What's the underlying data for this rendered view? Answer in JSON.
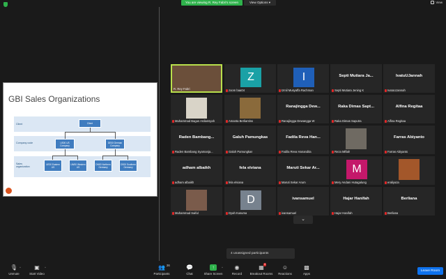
{
  "top": {
    "viewing_banner": "You are viewing R. Rey Fabri's screen",
    "view_options": "View Options",
    "view_label": "View"
  },
  "slide": {
    "title": "GBI Sales Organizations",
    "bands": [
      "Client",
      "Company code",
      "Sales organization"
    ],
    "client_box": "Client",
    "company_codes": [
      "US00 US Company",
      "DE00 German Company"
    ],
    "sales_orgs": [
      "UE00 Eastern US",
      "UW00 Western US",
      "DN00 Northern Germany",
      "DS00 Southern Germany"
    ]
  },
  "tiles": [
    {
      "kind": "photo",
      "label": "R. Rey Fabri",
      "active": true,
      "muted": false,
      "color": "#6b4f3a"
    },
    {
      "kind": "letter",
      "letter": "Z",
      "label": "zoom baa04",
      "color": "#1aa1a6",
      "muted": true
    },
    {
      "kind": "letter",
      "letter": "I",
      "label": "Izmil Musyaffa Rachman",
      "color": "#1f5fb8",
      "muted": true
    },
    {
      "kind": "name",
      "name": "Septi Mutiara Ja...",
      "label": "Septi Mutiara Jening K",
      "muted": true
    },
    {
      "kind": "name",
      "name": "IvatuUJannah",
      "label": "IvatuUJannah",
      "muted": true
    },
    {
      "kind": "photo",
      "label": "Muhammad Bagus Ardiansyah",
      "muted": true,
      "color": "#d9d4c8"
    },
    {
      "kind": "photo",
      "label": "Amanta Berliantino",
      "muted": true,
      "color": "#8a6a3b"
    },
    {
      "kind": "name",
      "name": "Ranajingga Dew...",
      "label": "Ranajingga Dewangga W",
      "muted": true
    },
    {
      "kind": "name",
      "name": "Raka Dimas Sapt...",
      "label": "Raka Dimas Saputra",
      "muted": true
    },
    {
      "kind": "name",
      "name": "Alfina Regitaa",
      "label": "Alfina Regitaa",
      "muted": true
    },
    {
      "kind": "name",
      "name": "Raden Bambang...",
      "label": "Raden Bambang Syamanja...",
      "muted": true
    },
    {
      "kind": "name",
      "name": "Galuh Pamungkas",
      "label": "Galuh Pamungkas",
      "muted": true
    },
    {
      "kind": "name",
      "name": "Fadila Reva Han...",
      "label": "Fadila Reva Hanandita",
      "muted": true
    },
    {
      "kind": "photo",
      "label": "Reza Miftah",
      "muted": true,
      "color": "#6f6a62"
    },
    {
      "kind": "name",
      "name": "Farras Abiyanto",
      "label": "Farras Abiyanto",
      "muted": true
    },
    {
      "kind": "name",
      "name": "adham albaikh",
      "label": "adham albaikh",
      "muted": true
    },
    {
      "kind": "name",
      "name": "fela elviana",
      "label": "fela elviana",
      "muted": true
    },
    {
      "kind": "name",
      "name": "Maruti Sekar Ar...",
      "label": "Maruti Sekar Arum",
      "muted": true
    },
    {
      "kind": "letter",
      "letter": "M",
      "label": "Mery Andani Hutagalung",
      "color": "#c4186a",
      "muted": true
    },
    {
      "kind": "photo",
      "label": "eraliyaza",
      "muted": true,
      "color": "#a3572a"
    },
    {
      "kind": "photo",
      "label": "Muhammad Saiful",
      "muted": true,
      "color": "#7a5b4b"
    },
    {
      "kind": "letter",
      "letter": "D",
      "label": "Dyah Kusuma",
      "color": "#77828e",
      "muted": true
    },
    {
      "kind": "name",
      "name": "ivansamuel",
      "label": "ivansamuel",
      "muted": true
    },
    {
      "kind": "name",
      "name": "Hajar Hanifah",
      "label": "Hajar Hanifah",
      "muted": true
    },
    {
      "kind": "name",
      "name": "Berliana",
      "label": "Berliana",
      "muted": true
    }
  ],
  "unassigned": "4 unassigned participants",
  "toolbar": {
    "unmute": "Unmute",
    "start_video": "Start Video",
    "participants": "Participants",
    "participants_count": "26",
    "chat": "Chat",
    "share_screen": "Share Screen",
    "record": "Record",
    "breakout_rooms": "Breakout Rooms",
    "breakout_badge": "4",
    "reactions": "Reactions",
    "apps": "Apps",
    "leave": "Leave Room"
  },
  "colors": {
    "accent_green": "#2fb24c",
    "leave_blue": "#0e72ed",
    "active_border": "#b9e04c",
    "mute_red": "#e02828"
  }
}
